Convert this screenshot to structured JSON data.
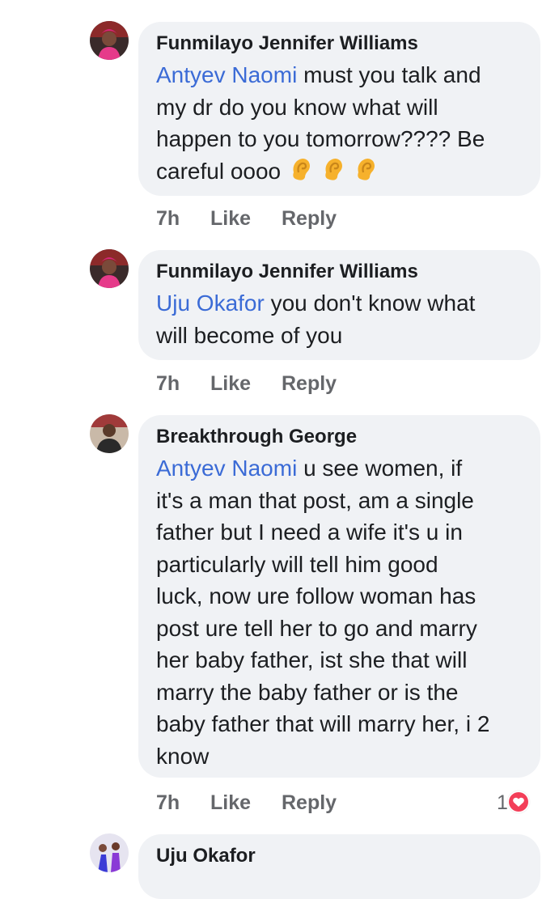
{
  "comments": [
    {
      "author": "Funmilayo Jennifer Williams",
      "mention": "Antyev Naomi",
      "text_lines": [
        " must you talk and",
        "my dr do you know what will",
        "happen to you tomorrow???? Be",
        "careful oooo"
      ],
      "emoji": [
        "ear-icon",
        "ear-icon",
        "ear-icon"
      ],
      "time": "7h",
      "like": "Like",
      "reply": "Reply"
    },
    {
      "author": "Funmilayo Jennifer Williams",
      "mention": "Uju Okafor",
      "text_lines": [
        " you don't know what",
        "will become of you"
      ],
      "time": "7h",
      "like": "Like",
      "reply": "Reply"
    },
    {
      "author": "Breakthrough George",
      "mention": "Antyev Naomi",
      "text_lines": [
        " u see women, if",
        "it's a man that post, am a single",
        "father but I need a wife  it's u in",
        "particularly will tell him good",
        "luck, now ure follow woman has",
        "post ure tell her to go and marry",
        "her baby father, ist she that will",
        "marry the baby father or is the",
        "baby father that will marry her, i 2",
        "know"
      ],
      "time": "7h",
      "like": "Like",
      "reply": "Reply",
      "reaction_count": "1",
      "reaction_icon": "heart-icon"
    },
    {
      "author": "Uju Okafor"
    }
  ],
  "colors": {
    "mention": "#3b6bd6",
    "bubble": "#f0f2f5",
    "muted": "#65676b",
    "heart": "#f33e58"
  }
}
